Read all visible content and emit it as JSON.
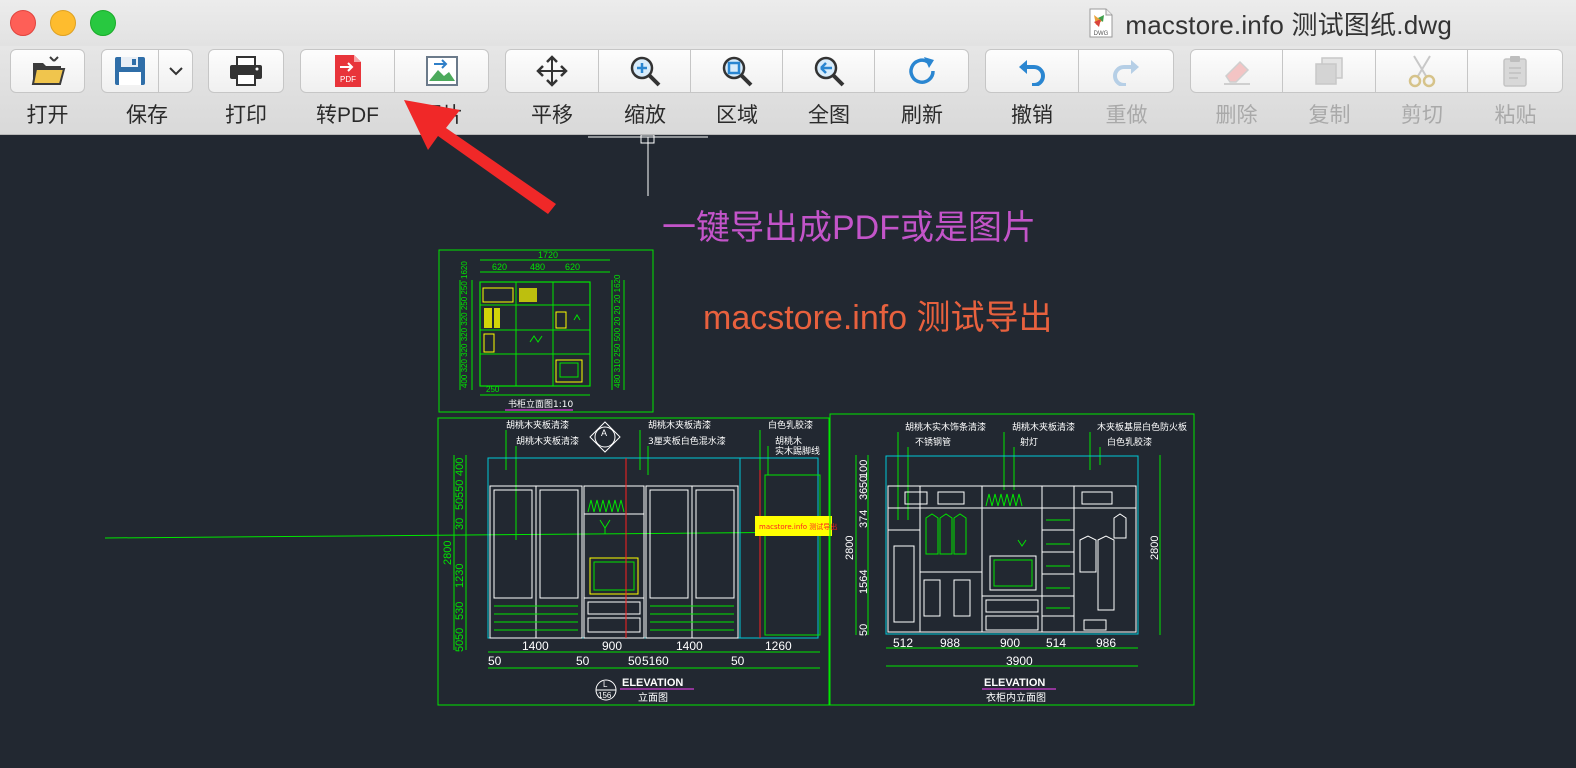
{
  "window": {
    "title": "macstore.info 测试图纸.dwg",
    "file_type_badge": "DWG"
  },
  "toolbar": {
    "open": "打开",
    "save": "保存",
    "print": "打印",
    "to_pdf": "转PDF",
    "image": "图片",
    "pan": "平移",
    "zoom": "缩放",
    "region": "区域",
    "full_view": "全图",
    "refresh": "刷新",
    "undo": "撤销",
    "redo": "重做",
    "delete": "删除",
    "copy": "复制",
    "cut": "剪切",
    "paste": "粘贴",
    "pdf_badge": "PDF"
  },
  "overlay": {
    "headline": "一键导出成PDF或是图片",
    "subline": "macstore.info 测试导出"
  },
  "drawing": {
    "top_dims": [
      "1720",
      "620",
      "480",
      "620"
    ],
    "top_left_dims": "400 320 320 320 320 250 250 1620",
    "top_right_dims": "480 310 250 500 20 20 20 1620",
    "top_bottom_dim": "250",
    "top_caption": "书柜立面图1:10",
    "left_notes": [
      "胡桃木夹板清漆",
      "胡桃木夹板清漆",
      "胡桃木夹板清漆",
      "3厘夹板白色混水漆",
      "白色乳胶漆",
      "胡桃木",
      "实木踢脚线"
    ],
    "left_vert_dims": [
      "400",
      "30",
      "50",
      "550",
      "1230",
      "2800",
      "530",
      "50",
      "50"
    ],
    "left_bottom_dims": [
      "1400",
      "900",
      "1400",
      "1260"
    ],
    "left_bottom_dims2": [
      "50",
      "50",
      "50",
      "50",
      "5160"
    ],
    "section_marker": "A",
    "watermark": "macstore.info 测试导出",
    "left_caption_en": "ELEVATION",
    "left_caption_cn": "立面图",
    "left_scale_top": "L",
    "left_scale_bottom": "156",
    "right_notes": [
      "胡桃木实木饰条清漆",
      "不锈钢管",
      "胡桃木夹板清漆",
      "射灯",
      "木夹板基层白色防火板",
      "白色乳胶漆"
    ],
    "right_vert_dims": [
      "100",
      "374",
      "36",
      "50",
      "2800",
      "1564",
      "50"
    ],
    "right_side_dim": "2800",
    "right_bottom_dims": [
      "512",
      "988",
      "900",
      "514",
      "986"
    ],
    "right_total": "3900",
    "right_caption_en": "ELEVATION",
    "right_caption_cn": "衣柜内立面图"
  },
  "colors": {
    "canvas_bg": "#222831",
    "cad_green": "#00e600",
    "cad_yellow": "#ffff00",
    "cad_cyan": "#00c8d8",
    "cad_white": "#ffffff",
    "cad_red": "#ff2020",
    "cad_magenta": "#ff40ff",
    "overlay_purple": "#c354c9",
    "overlay_orange": "#e8613e",
    "arrow_red": "#f02828"
  }
}
